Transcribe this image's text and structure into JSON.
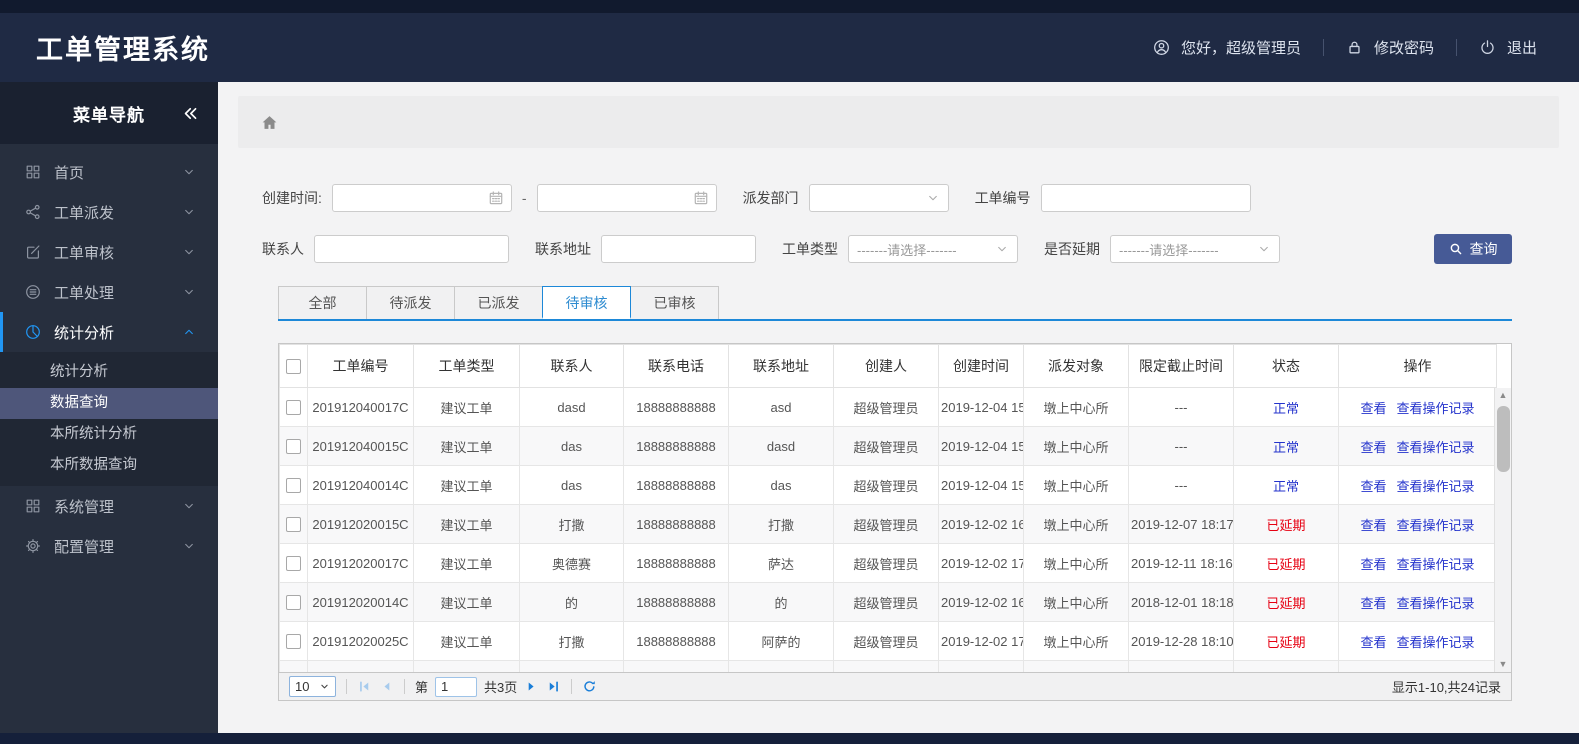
{
  "colors": {
    "header_bg": "#1f2a44",
    "sidebar_bg": "#272f3e",
    "sidebar_dark": "#1a2130",
    "submenu_bg": "#202734",
    "submenu_selected": "#4e567a",
    "accent_blue": "#2196f3",
    "tab_blue": "#1d88d8",
    "button_blue": "#465a96",
    "link_blue": "#2433cc",
    "status_normal": "#2433cc",
    "status_delayed": "#e60012",
    "pager_blue": "#1a7ed8",
    "pager_disabled": "#a7cbed"
  },
  "header": {
    "title": "工单管理系统",
    "greeting": "您好，超级管理员",
    "change_password": "修改密码",
    "logout": "退出"
  },
  "sidebar": {
    "nav_title": "菜单导航",
    "menu": [
      {
        "label": "首页",
        "icon": "home-grid-icon"
      },
      {
        "label": "工单派发",
        "icon": "share-icon"
      },
      {
        "label": "工单审核",
        "icon": "edit-icon"
      },
      {
        "label": "工单处理",
        "icon": "process-icon"
      },
      {
        "label": "统计分析",
        "icon": "pie-chart-icon",
        "active": true,
        "expanded": true,
        "children": [
          {
            "label": "统计分析"
          },
          {
            "label": "数据查询",
            "selected": true
          },
          {
            "label": "本所统计分析"
          },
          {
            "label": "本所数据查询"
          }
        ]
      },
      {
        "label": "系统管理",
        "icon": "system-grid-icon"
      },
      {
        "label": "配置管理",
        "icon": "gear-icon"
      }
    ]
  },
  "filters": {
    "create_time_label": "创建时间:",
    "date_separator": "-",
    "create_time_start_value": "",
    "create_time_end_value": "",
    "dispatch_dept_label": "派发部门",
    "dispatch_dept_value": "",
    "order_no_label": "工单编号",
    "order_no_value": "",
    "contact_label": "联系人",
    "contact_value": "",
    "address_label": "联系地址",
    "address_value": "",
    "order_type_label": "工单类型",
    "order_type_placeholder": "-------请选择-------",
    "delay_label": "是否延期",
    "delay_placeholder": "-------请选择-------",
    "search_button": "查询"
  },
  "tabs": [
    {
      "label": "全部"
    },
    {
      "label": "待派发"
    },
    {
      "label": "已派发"
    },
    {
      "label": "待审核",
      "active": true
    },
    {
      "label": "已审核"
    }
  ],
  "table": {
    "columns": [
      "工单编号",
      "工单类型",
      "联系人",
      "联系电话",
      "联系地址",
      "创建人",
      "创建时间",
      "派发对象",
      "限定截止时间",
      "状态",
      "操作"
    ],
    "action_labels": [
      "查看",
      "查看操作记录"
    ],
    "rows": [
      {
        "order_no": "201912040017C",
        "type": "建议工单",
        "contact": "dasd",
        "phone": "18888888888",
        "address": "asd",
        "creator": "超级管理员",
        "created": "2019-12-04 15",
        "target": "墩上中心所",
        "deadline": "---",
        "status": "正常",
        "status_type": "normal"
      },
      {
        "order_no": "201912040015C",
        "type": "建议工单",
        "contact": "das",
        "phone": "18888888888",
        "address": "dasd",
        "creator": "超级管理员",
        "created": "2019-12-04 15",
        "target": "墩上中心所",
        "deadline": "---",
        "status": "正常",
        "status_type": "normal"
      },
      {
        "order_no": "201912040014C",
        "type": "建议工单",
        "contact": "das",
        "phone": "18888888888",
        "address": "das",
        "creator": "超级管理员",
        "created": "2019-12-04 15",
        "target": "墩上中心所",
        "deadline": "---",
        "status": "正常",
        "status_type": "normal"
      },
      {
        "order_no": "201912020015C",
        "type": "建议工单",
        "contact": "打撒",
        "phone": "18888888888",
        "address": "打撒",
        "creator": "超级管理员",
        "created": "2019-12-02 16",
        "target": "墩上中心所",
        "deadline": "2019-12-07 18:17",
        "status": "已延期",
        "status_type": "delayed"
      },
      {
        "order_no": "201912020017C",
        "type": "建议工单",
        "contact": "奥德赛",
        "phone": "18888888888",
        "address": "萨达",
        "creator": "超级管理员",
        "created": "2019-12-02 17",
        "target": "墩上中心所",
        "deadline": "2019-12-11 18:16",
        "status": "已延期",
        "status_type": "delayed"
      },
      {
        "order_no": "201912020014C",
        "type": "建议工单",
        "contact": "的",
        "phone": "18888888888",
        "address": "的",
        "creator": "超级管理员",
        "created": "2019-12-02 16",
        "target": "墩上中心所",
        "deadline": "2018-12-01 18:18",
        "status": "已延期",
        "status_type": "delayed"
      },
      {
        "order_no": "201912020025C",
        "type": "建议工单",
        "contact": "打撒",
        "phone": "18888888888",
        "address": "阿萨的",
        "creator": "超级管理员",
        "created": "2019-12-02 17",
        "target": "墩上中心所",
        "deadline": "2019-12-28 18:10",
        "status": "已延期",
        "status_type": "delayed"
      }
    ],
    "partial_row_visible": true
  },
  "pagination": {
    "page_size": "10",
    "page_prefix": "第",
    "current_page": "1",
    "total_pages": "共3页",
    "summary": "显示1-10,共24记录"
  }
}
